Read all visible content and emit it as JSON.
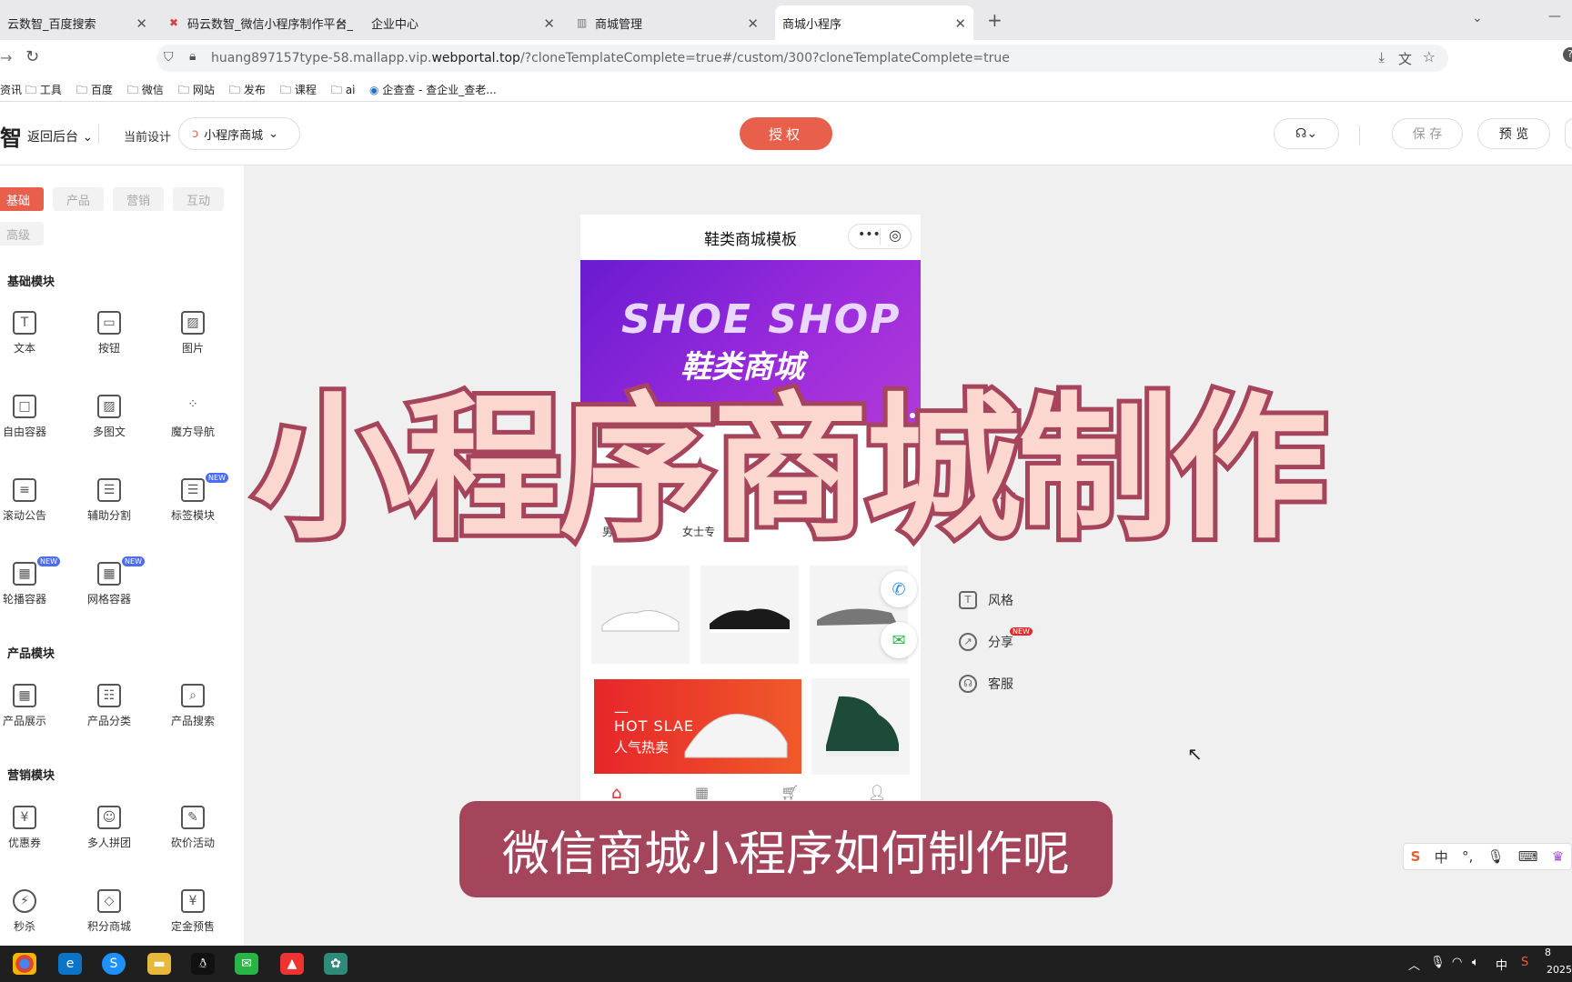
{
  "browser": {
    "tabs": [
      {
        "title": "云数智_百度搜索",
        "active": false
      },
      {
        "title": "码云数智_微信小程序制作平台_",
        "active": false
      },
      {
        "title": "企业中心",
        "active": false
      },
      {
        "title": "商城管理",
        "active": false
      },
      {
        "title": "商城小程序",
        "active": true
      }
    ],
    "url_prefix": "huang897157type-58.mallapp.vip.",
    "url_domain": "webportal.top",
    "url_suffix": "/?cloneTemplateComplete=true#/custom/300?cloneTemplateComplete=true",
    "bookmarks": [
      "资讯",
      "工具",
      "百度",
      "微信",
      "网站",
      "发布",
      "课程",
      "ai",
      "企查查 - 查企业_查老..."
    ]
  },
  "app_header": {
    "logo_char": "智",
    "back_label": "返回后台",
    "current_design_label": "当前设计",
    "design_select": "小程序商城",
    "auth_label": "授权",
    "save_label": "保 存",
    "preview_label": "预 览"
  },
  "sidebar": {
    "category_tabs": [
      "基础",
      "产品",
      "营销",
      "互动",
      "高级"
    ],
    "sections": [
      {
        "title": "基础模块",
        "items": [
          {
            "label": "文本",
            "icon": "T",
            "new": false
          },
          {
            "label": "按钮",
            "icon": "▭",
            "new": false
          },
          {
            "label": "图片",
            "icon": "▨",
            "new": false
          },
          {
            "label": "自由容器",
            "icon": "□",
            "new": false
          },
          {
            "label": "多图文",
            "icon": "▨",
            "new": false
          },
          {
            "label": "魔方导航",
            "icon": "⁘",
            "new": false
          },
          {
            "label": "滚动公告",
            "icon": "≡",
            "new": false
          },
          {
            "label": "辅助分割",
            "icon": "☰",
            "new": false
          },
          {
            "label": "标签模块",
            "icon": "☰",
            "new": true
          },
          {
            "label": "轮播容器",
            "icon": "▦",
            "new": true
          },
          {
            "label": "网格容器",
            "icon": "▦",
            "new": true
          }
        ]
      },
      {
        "title": "产品模块",
        "items": [
          {
            "label": "产品展示",
            "icon": "▦",
            "new": false
          },
          {
            "label": "产品分类",
            "icon": "☷",
            "new": false
          },
          {
            "label": "产品搜索",
            "icon": "⌕",
            "new": false
          }
        ]
      },
      {
        "title": "营销模块",
        "items": [
          {
            "label": "优惠券",
            "icon": "¥",
            "new": false
          },
          {
            "label": "多人拼团",
            "icon": "☺",
            "new": false
          },
          {
            "label": "砍价活动",
            "icon": "✎",
            "new": false
          },
          {
            "label": "秒杀",
            "icon": "⚡",
            "new": false
          },
          {
            "label": "积分商城",
            "icon": "◇",
            "new": false
          },
          {
            "label": "定金预售",
            "icon": "¥",
            "new": false
          }
        ]
      }
    ],
    "new_badge": "NEW"
  },
  "phone": {
    "title": "鞋类商城模板",
    "capsule_more": "•••",
    "capsule_close": "◎",
    "banner_en": "SHOE SHOP",
    "banner_cn": "鞋类商城",
    "category_labels": [
      "男士",
      "女士专"
    ],
    "hot_en": "HOT  SLAE",
    "hot_cn": "人气热卖",
    "bottom_nav_icons": [
      "home-icon",
      "grid-icon",
      "cart-icon",
      "user-icon"
    ]
  },
  "right_menu": [
    {
      "label": "风格",
      "icon": "shirt-icon",
      "new": false
    },
    {
      "label": "分享",
      "icon": "share-icon",
      "new": true
    },
    {
      "label": "客服",
      "icon": "headset-icon",
      "new": false
    }
  ],
  "overlay": {
    "big_title": "小程序商城制作",
    "subtitle": "微信商城小程序如何制作呢"
  },
  "ime": {
    "lang": "中"
  },
  "taskbar": {
    "tray_lang": "中",
    "clock_partial": "8",
    "year_partial": "2025"
  },
  "colors": {
    "accent": "#e8604c",
    "overlay_stroke": "#a5445a",
    "overlay_fill": "#fbd7cf",
    "subtitle_bg": "#a4455b"
  }
}
